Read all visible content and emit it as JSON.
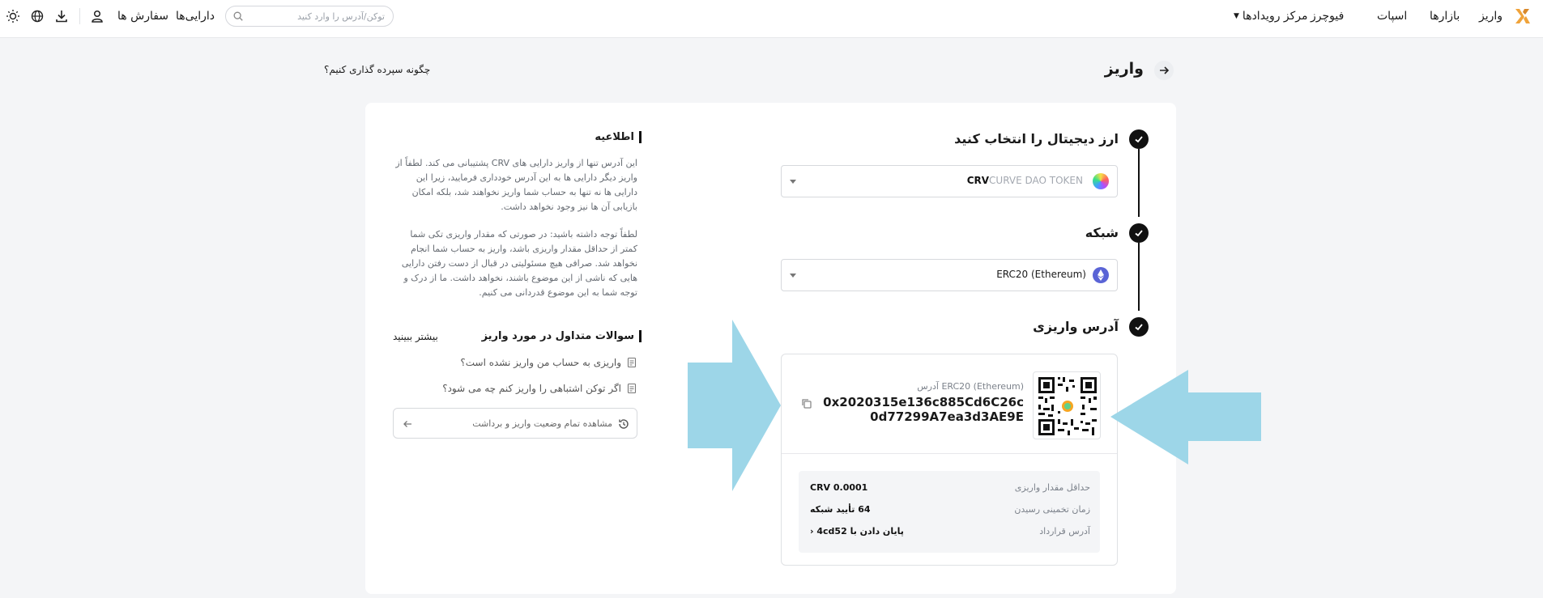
{
  "nav": {
    "deposit": "واریز",
    "markets": "بازارها",
    "spot": "اسپات",
    "futures": "فیوچرز",
    "events": "مرکز رویدادها",
    "assets": "دارایی‌ها",
    "orders": "سفارش ها",
    "search_placeholder": "توکن/آدرس را وارد کنید"
  },
  "page": {
    "title": "واریز",
    "how_to": "چگونه سپرده گذاری کنیم؟"
  },
  "steps": {
    "coin_title": "ارز دیجیتال را انتخاب کنید",
    "coin_symbol": "CRV",
    "coin_name": "CURVE DAO TOKEN",
    "network_title": "شبکه",
    "network_value": "ERC20 (Ethereum)",
    "address_title": "آدرس واریزی"
  },
  "address": {
    "label": "ERC20 (Ethereum) آدرس",
    "value": "0x2020315e136c885Cd6C26c0d77299A7ea3d3AE9E",
    "min_label": "حداقل مقدار واریزی",
    "min_value": "CRV 0.0001",
    "eta_label": "زمان تخمینی رسیدن",
    "eta_value": "64 تأیید شبکه",
    "contract_label": "آدرس قرارداد",
    "contract_value": "پایان دادن با 4cd52 ‹"
  },
  "info": {
    "title": "اطلاعیه",
    "p1": "این آدرس تنها از واریز دارایی های CRV پشتیبانی می کند. لطفاً از واریز دیگر دارایی ها به این آدرس خودداری فرمایید، زیرا این دارایی ها نه تنها به حساب شما واریز نخواهند شد، بلکه امکان بازیابی آن ها نیز وجود نخواهد داشت.",
    "p2": "لطفاً توجه داشته باشید: در صورتی که مقدار واریزی تکی شما کمتر از حداقل مقدار واریزی باشد، واریز به حساب شما انجام نخواهد شد. صرافی هیچ مسئولیتی در قبال از دست رفتن دارایی هایی که ناشی از این موضوع باشند، نخواهد داشت. ما از درک و توجه شما به این موضوع قدردانی می کنیم."
  },
  "faq": {
    "title": "سوالات متداول در مورد واریز",
    "more": "بیشتر ببینید",
    "q1": "واریزی به حساب من واریز نشده است؟",
    "q2": "اگر توکن اشتباهی را واریز کنم چه می شود؟",
    "history": "مشاهده تمام وضعیت واریز و برداشت"
  },
  "colors": {
    "accent_black": "#111111",
    "annotation_arrow": "#9dd6e8",
    "logo_orange": "#f0a33a"
  }
}
